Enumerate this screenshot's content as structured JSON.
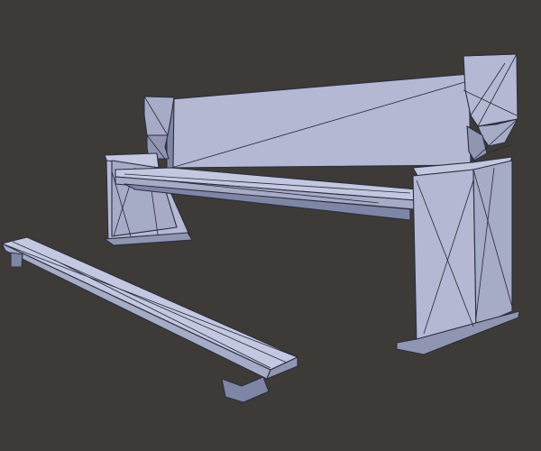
{
  "scene": {
    "background": "#3d3a38",
    "mesh_color": "#b4b8d2",
    "wire_color": "#262a3a",
    "objects": [
      "church-pew",
      "kneeler-bench"
    ]
  }
}
